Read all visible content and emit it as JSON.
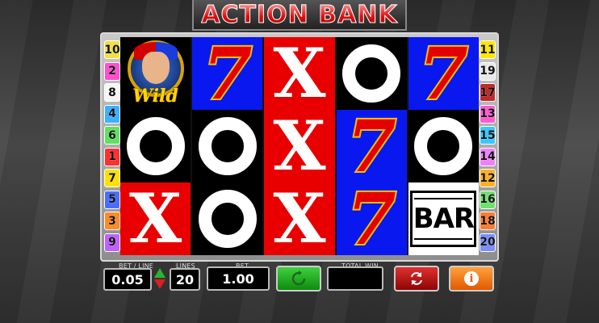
{
  "game": {
    "title": "ACTION BANK"
  },
  "paylines": {
    "left": [
      {
        "num": "10",
        "color": "#f0e040"
      },
      {
        "num": "2",
        "color": "#ff4fcf"
      },
      {
        "num": "8",
        "color": "#f5f5f5"
      },
      {
        "num": "4",
        "color": "#3cb0ff"
      },
      {
        "num": "6",
        "color": "#60e060"
      },
      {
        "num": "1",
        "color": "#ff3030"
      },
      {
        "num": "7",
        "color": "#ffe000"
      },
      {
        "num": "5",
        "color": "#4a6cff"
      },
      {
        "num": "3",
        "color": "#ff8a2a"
      },
      {
        "num": "9",
        "color": "#c060ff"
      }
    ],
    "right": [
      {
        "num": "11",
        "color": "#ffe600"
      },
      {
        "num": "19",
        "color": "#e8e8e8"
      },
      {
        "num": "17",
        "color": "#c02a2a"
      },
      {
        "num": "13",
        "color": "#ff5ad0"
      },
      {
        "num": "15",
        "color": "#38c8ff"
      },
      {
        "num": "14",
        "color": "#f080ff"
      },
      {
        "num": "12",
        "color": "#ffb020"
      },
      {
        "num": "16",
        "color": "#70e070"
      },
      {
        "num": "18",
        "color": "#ff7a30"
      },
      {
        "num": "20",
        "color": "#7a8cff"
      }
    ]
  },
  "reels": [
    [
      {
        "symbol": "wild",
        "bg": "black",
        "label": "Wild"
      },
      {
        "symbol": "o",
        "bg": "black"
      },
      {
        "symbol": "x",
        "bg": "red",
        "label": "X"
      }
    ],
    [
      {
        "symbol": "7",
        "bg": "blue",
        "label": "7"
      },
      {
        "symbol": "o",
        "bg": "black"
      },
      {
        "symbol": "o",
        "bg": "black"
      }
    ],
    [
      {
        "symbol": "x",
        "bg": "red",
        "label": "X"
      },
      {
        "symbol": "x",
        "bg": "red",
        "label": "X"
      },
      {
        "symbol": "x",
        "bg": "red",
        "label": "X"
      }
    ],
    [
      {
        "symbol": "o",
        "bg": "black"
      },
      {
        "symbol": "7",
        "bg": "blue",
        "label": "7"
      },
      {
        "symbol": "7",
        "bg": "blue",
        "label": "7"
      }
    ],
    [
      {
        "symbol": "7",
        "bg": "blue",
        "label": "7"
      },
      {
        "symbol": "o",
        "bg": "black"
      },
      {
        "symbol": "bar",
        "bg": "white",
        "label": "BAR"
      }
    ]
  ],
  "controls": {
    "bet_per_line_label": "BET / LINE",
    "bet_per_line_value": "0.05",
    "lines_label": "LINES",
    "lines_value": "20",
    "bet_label": "BET",
    "bet_value": "1.00",
    "total_win_label": "TOTAL WIN",
    "total_win_value": "",
    "spin_icon": "refresh-icon",
    "autoplay_icon": "autoplay-icon",
    "info_label": "i"
  }
}
